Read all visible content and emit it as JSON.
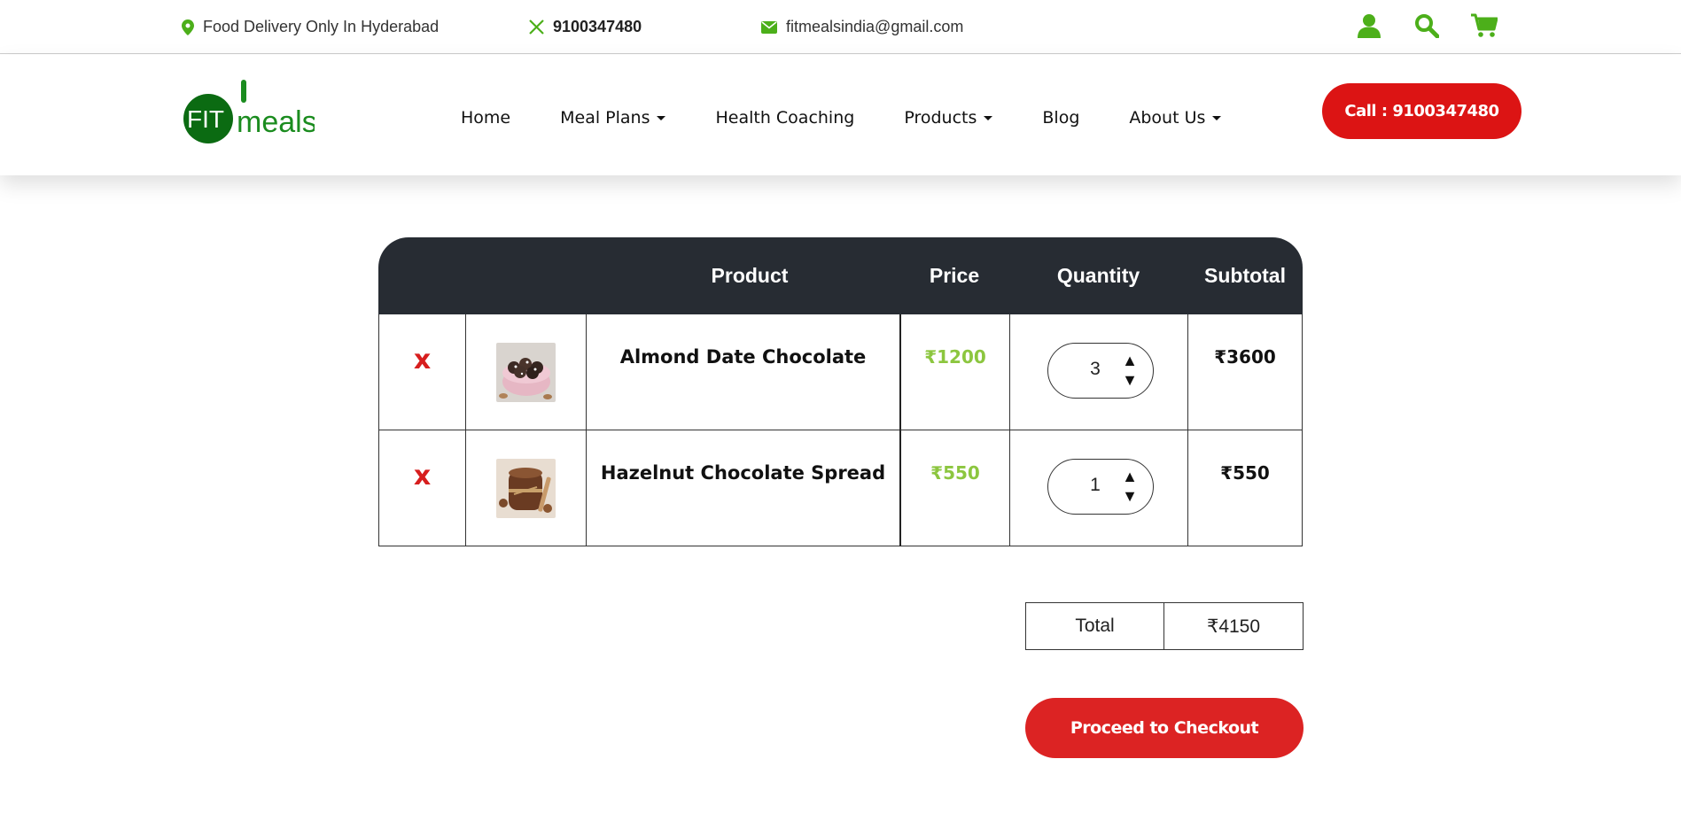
{
  "topbar": {
    "location": "Food Delivery Only In Hyderabad",
    "phone": "9100347480",
    "email": "fitmealsindia@gmail.com",
    "icons": [
      "user-icon",
      "search-icon",
      "cart-icon"
    ]
  },
  "brand": {
    "logo_fit": "FIT",
    "logo_meals": "meals",
    "primary_green": "#4caf1a",
    "accent_red": "#dc1414",
    "dark": "#272c33"
  },
  "nav": {
    "items": [
      {
        "label": "Home",
        "dropdown": false
      },
      {
        "label": "Meal Plans",
        "dropdown": true
      },
      {
        "label": "Health Coaching",
        "dropdown": false
      },
      {
        "label": "Products",
        "dropdown": true
      },
      {
        "label": "Blog",
        "dropdown": false
      },
      {
        "label": "About Us",
        "dropdown": true
      }
    ],
    "call_button": "Call : 9100347480"
  },
  "cart": {
    "headers": {
      "product": "Product",
      "price": "Price",
      "quantity": "Quantity",
      "subtotal": "Subtotal"
    },
    "remove_symbol": "x",
    "qty_up": "▲",
    "qty_down": "▼",
    "items": [
      {
        "name": "Almond Date Chocolate",
        "price": "₹1200",
        "quantity": "3",
        "subtotal": "₹3600"
      },
      {
        "name": "Hazelnut Chocolate Spread",
        "price": "₹550",
        "quantity": "1",
        "subtotal": "₹550"
      }
    ]
  },
  "totals": {
    "label": "Total",
    "value": "₹4150"
  },
  "checkout_button": "Proceed to Checkout"
}
